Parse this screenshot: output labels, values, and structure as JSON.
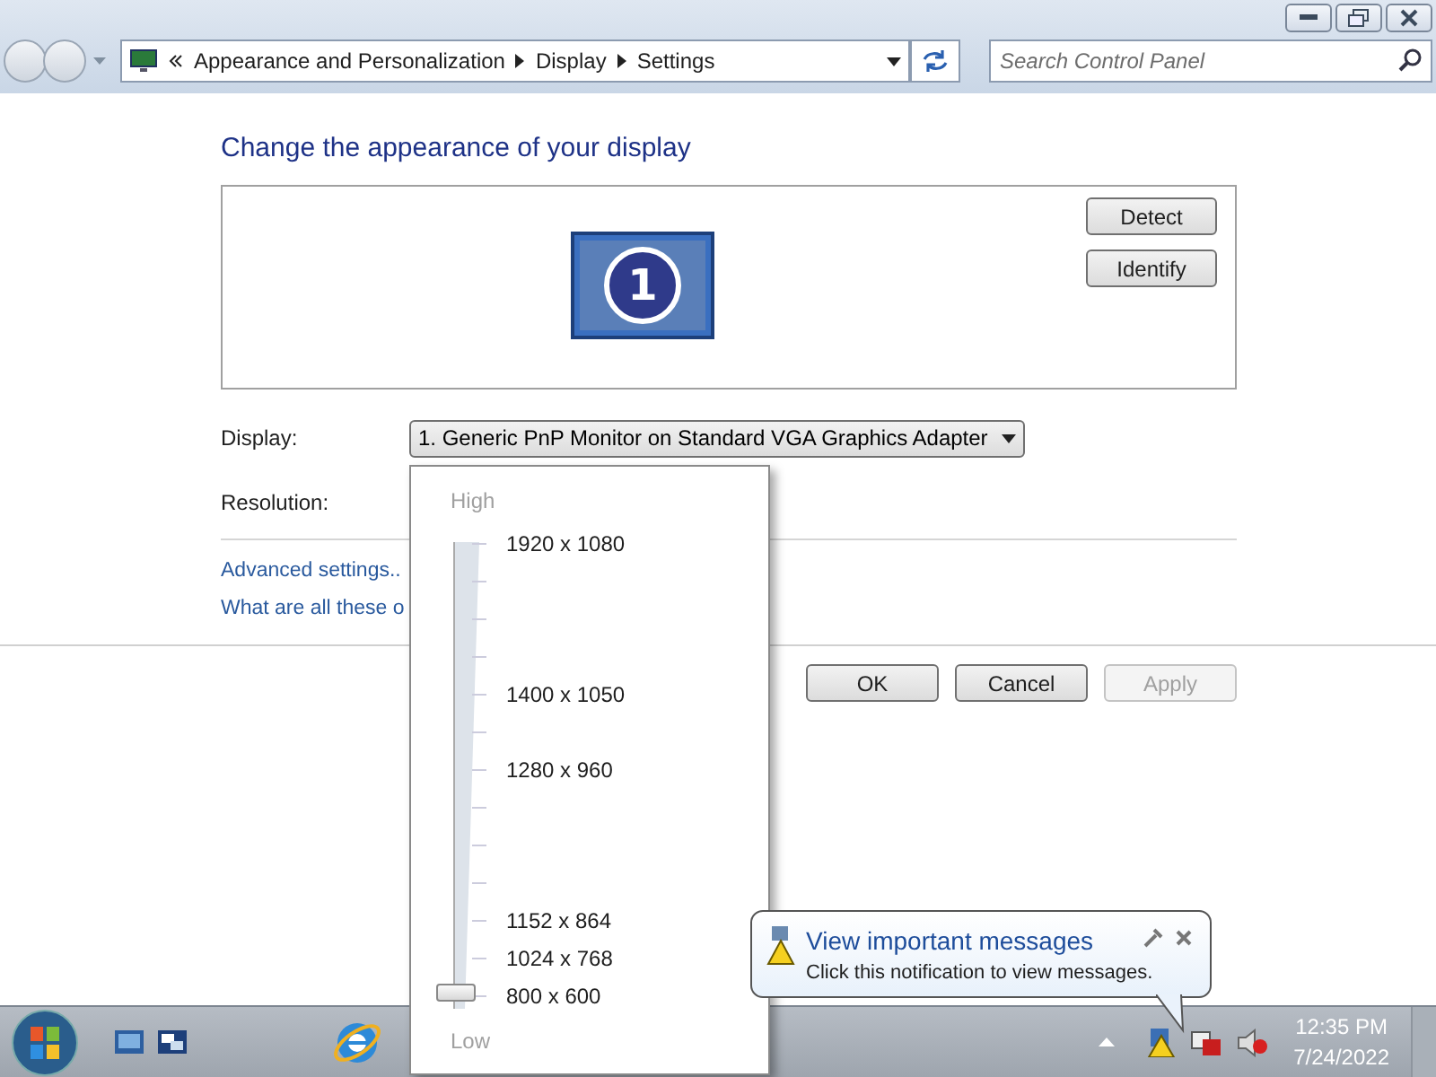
{
  "address_bar": {
    "crumbs": [
      "Appearance and Personalization",
      "Display",
      "Settings"
    ],
    "search_placeholder": "Search Control Panel"
  },
  "heading": "Change the appearance of your display",
  "preview": {
    "monitor_number": "1",
    "buttons": [
      "Detect",
      "Identify"
    ]
  },
  "display": {
    "label": "Display:",
    "value": "1. Generic PnP Monitor on Standard VGA Graphics Adapter"
  },
  "resolution": {
    "label": "Resolution:"
  },
  "links": [
    "Advanced settings..",
    "What are all these o"
  ],
  "dialog_buttons": [
    {
      "label": "OK",
      "disabled": false
    },
    {
      "label": "Cancel",
      "disabled": false
    },
    {
      "label": "Apply",
      "disabled": true
    }
  ],
  "resolution_popup": {
    "high": "High",
    "low": "Low",
    "level": 0,
    "marks": [
      "1920 x 1080",
      "1400 x 1050",
      "1280 x 960",
      "1152 x 864",
      "1024 x 768",
      "800 x 600"
    ]
  },
  "notification": {
    "title": "View important messages",
    "text": "Click this notification to view messages."
  },
  "taskbar": {
    "time": "12:35 PM",
    "date": "7/24/2022"
  }
}
